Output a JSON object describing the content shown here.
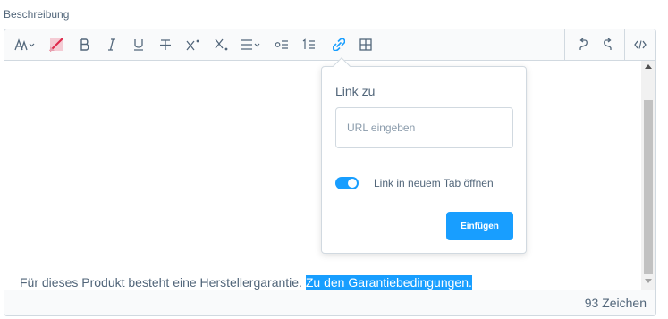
{
  "field": {
    "label": "Beschreibung"
  },
  "toolbar": {
    "buttons": [
      {
        "name": "font-size",
        "icon": "font-size-icon"
      },
      {
        "name": "text-color",
        "icon": "text-color-icon"
      },
      {
        "name": "bold",
        "glyph": "B"
      },
      {
        "name": "italic",
        "glyph": "I"
      },
      {
        "name": "underline",
        "glyph": "U"
      },
      {
        "name": "strikethrough",
        "glyph": "T"
      },
      {
        "name": "superscript",
        "glyph": "X"
      },
      {
        "name": "subscript",
        "glyph": "X"
      },
      {
        "name": "align",
        "icon": "align-icon"
      },
      {
        "name": "unordered-list",
        "icon": "list-ul-icon"
      },
      {
        "name": "ordered-list",
        "icon": "list-ol-icon"
      },
      {
        "name": "link",
        "icon": "link-icon",
        "active": true
      },
      {
        "name": "table",
        "icon": "table-icon"
      },
      {
        "name": "undo",
        "icon": "undo-icon"
      },
      {
        "name": "redo",
        "icon": "redo-icon"
      },
      {
        "name": "code-view",
        "icon": "code-icon"
      }
    ]
  },
  "content": {
    "text_plain": "Für dieses Produkt besteht eine Herstellergarantie. ",
    "text_selected": "Zu den Garantiebedingungen."
  },
  "footer": {
    "char_count": "93 Zeichen"
  },
  "link_popover": {
    "title": "Link zu",
    "url_placeholder": "URL eingeben",
    "url_value": "",
    "new_tab_label": "Link in neuem Tab öffnen",
    "new_tab_enabled": true,
    "insert_label": "Einfügen"
  },
  "colors": {
    "accent": "#189eff",
    "text": "#52667a",
    "border": "#d1d9e0",
    "toolbar_bg": "#f9fafb"
  }
}
